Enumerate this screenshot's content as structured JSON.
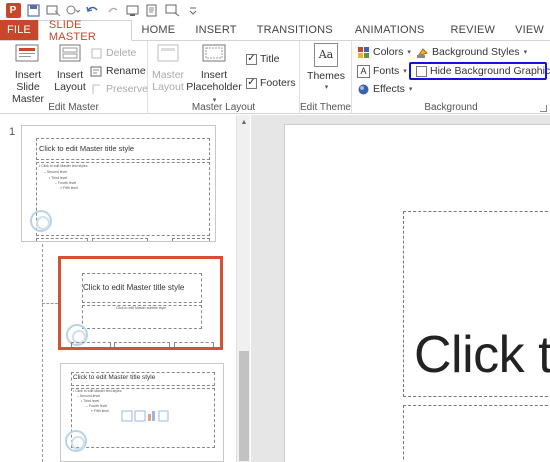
{
  "qat": {
    "icons": [
      "powerpoint-logo",
      "save-icon",
      "new-slide-icon",
      "shapes-icon",
      "undo-icon",
      "redo-icon",
      "start-from-beginning-icon",
      "spelling-icon",
      "format-painter-icon",
      "customize-icon"
    ]
  },
  "tabs": [
    {
      "label": "FILE"
    },
    {
      "label": "SLIDE MASTER"
    },
    {
      "label": "HOME"
    },
    {
      "label": "INSERT"
    },
    {
      "label": "TRANSITIONS"
    },
    {
      "label": "ANIMATIONS"
    },
    {
      "label": "REVIEW"
    },
    {
      "label": "VIEW"
    }
  ],
  "ribbon": {
    "edit_master": {
      "label": "Edit Master",
      "insert_slide_master": "Insert Slide\nMaster",
      "insert_layout": "Insert\nLayout",
      "delete": "Delete",
      "rename": "Rename",
      "preserve": "Preserve"
    },
    "master_layout": {
      "label": "Master Layout",
      "master_layout_btn": "Master\nLayout",
      "insert_placeholder": "Insert\nPlaceholder",
      "title": "Title",
      "footers": "Footers",
      "title_checked": true,
      "footers_checked": true
    },
    "edit_theme": {
      "label": "Edit Theme",
      "themes": "Themes",
      "themes_icon_text": "Aa"
    },
    "background": {
      "label": "Background",
      "colors": "Colors",
      "fonts": "Fonts",
      "effects": "Effects",
      "background_styles": "Background Styles",
      "hide_background_graphics": "Hide Background Graphics",
      "hide_checked": false
    }
  },
  "thumbnails": {
    "slide1_number": "1",
    "slide1_title": "Click to edit Master title style",
    "slide1_text": [
      "• Click to edit Master text styles",
      "– Second level",
      "• Third level",
      "– Fourth level",
      "» Fifth level"
    ],
    "slide2_title": "Click to edit Master title style",
    "slide2_subtitle": "Click to edit Master subtitle style",
    "slide3_title": "Click to edit Master title style",
    "slide3_text": [
      "• Click to edit Master text styles",
      "– Second level",
      "• Third level",
      "– Fourth level",
      "» Fifth level"
    ]
  },
  "editor": {
    "title_text": "Click t"
  },
  "colors": {
    "accent": "#c8472b",
    "highlight_box": "#1414d8",
    "selected_thumb_border": "#d2532f"
  }
}
